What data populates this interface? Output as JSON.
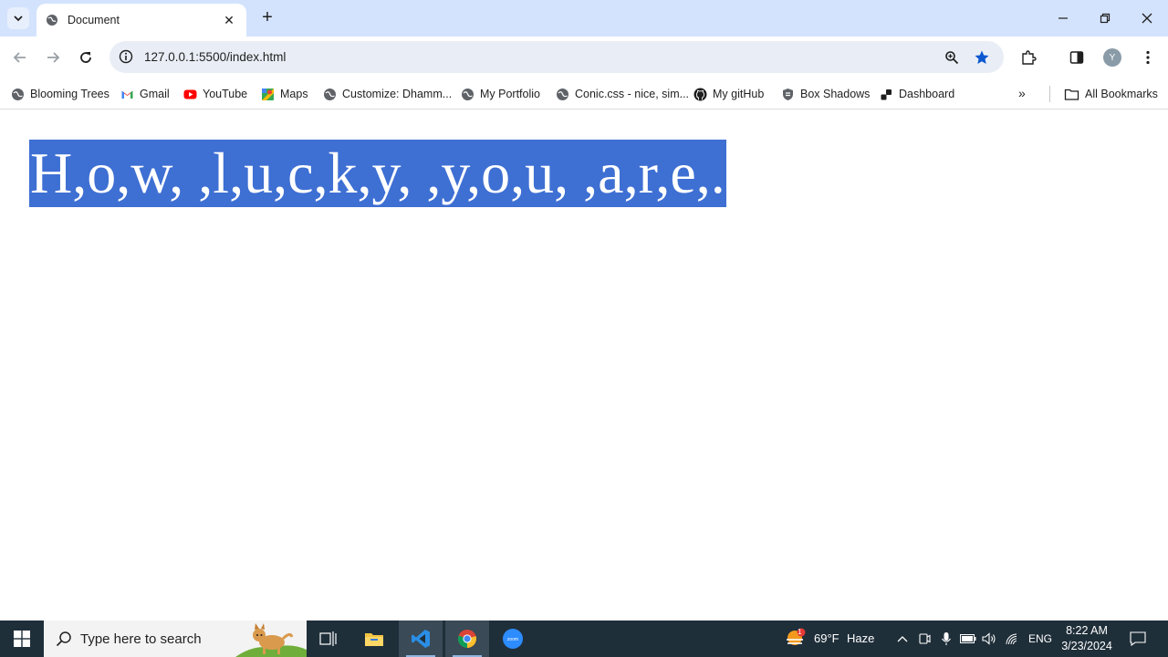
{
  "browser": {
    "tab": {
      "title": "Document"
    },
    "address": {
      "url": "127.0.0.1:5500/index.html"
    },
    "profile_initial": "Y"
  },
  "bookmarks": {
    "items": [
      {
        "label": "Blooming Trees",
        "icon": "globe-icon"
      },
      {
        "label": "Gmail",
        "icon": "gmail-icon"
      },
      {
        "label": "YouTube",
        "icon": "youtube-icon"
      },
      {
        "label": "Maps",
        "icon": "maps-icon"
      },
      {
        "label": "Customize: Dhamm...",
        "icon": "globe-icon"
      },
      {
        "label": "My Portfolio",
        "icon": "globe-icon"
      },
      {
        "label": "Conic.css - nice, sim...",
        "icon": "globe-icon"
      },
      {
        "label": "My gitHub",
        "icon": "github-icon"
      },
      {
        "label": "Box Shadows",
        "icon": "shield-icon"
      },
      {
        "label": "Dashboard",
        "icon": "dashboard-icon"
      }
    ],
    "all_bookmarks": "All Bookmarks"
  },
  "page": {
    "heading": "H,o,w, ,l,u,c,k,y, ,y,o,u, ,a,r,e,.",
    "selection_color": "#3e6fd3"
  },
  "taskbar": {
    "search_placeholder": "Type here to search",
    "weather": {
      "temp": "69°F",
      "condition": "Haze",
      "badge": "1"
    },
    "language": "ENG",
    "time": "8:22 AM",
    "date": "3/23/2024"
  },
  "colors": {
    "tabstrip": "#d3e3fd",
    "omnibox": "#e9eef6",
    "accent": "#0b57d0",
    "taskbar": "#1f2f3a"
  }
}
